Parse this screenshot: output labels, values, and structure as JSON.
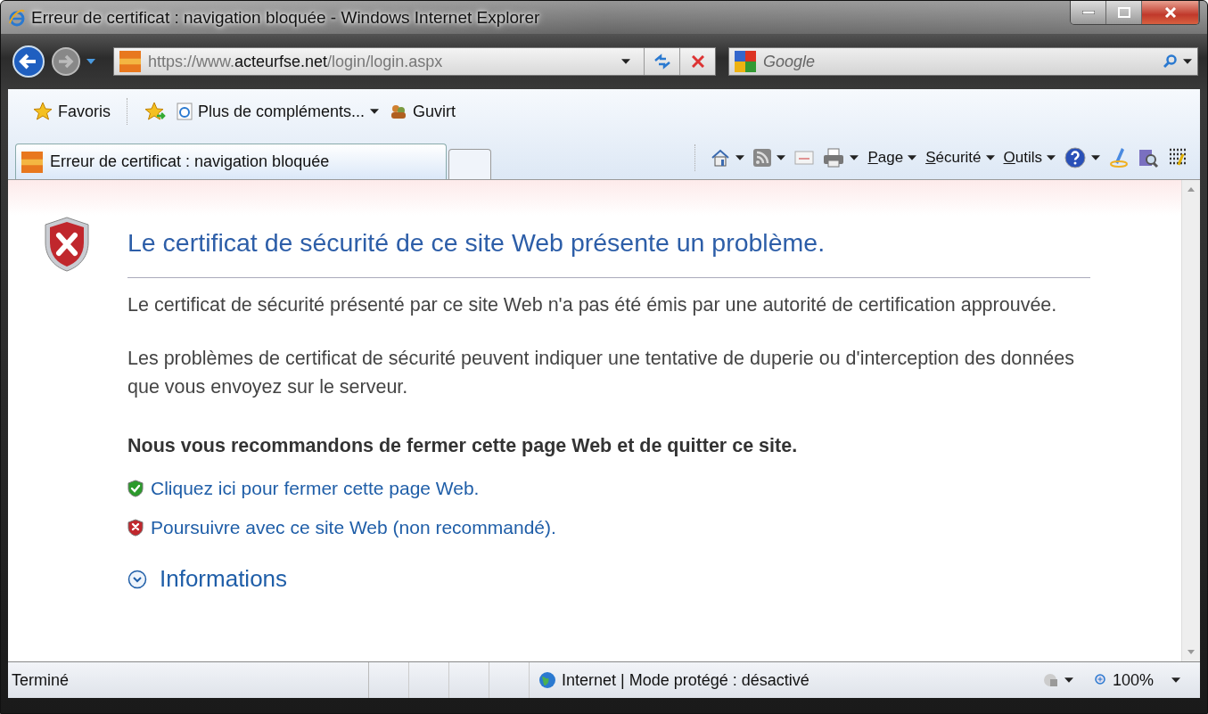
{
  "window": {
    "title": "Erreur de certificat : navigation bloquée - Windows Internet Explorer"
  },
  "address_bar": {
    "url_prefix": "https://www.",
    "url_domain": "acteurfse.net",
    "url_path": "/login/login.aspx"
  },
  "search": {
    "placeholder": "Google"
  },
  "favorites_bar": {
    "label": "Favoris",
    "items": [
      {
        "label": "Plus de compléments...",
        "kind": "dropdown"
      },
      {
        "label": "Guvirt",
        "kind": "link"
      }
    ]
  },
  "tabs": [
    {
      "label": "Erreur de certificat : navigation bloquée",
      "selected": true
    }
  ],
  "command_bar": {
    "menus": [
      "Page",
      "Sécurité",
      "Outils"
    ]
  },
  "content": {
    "heading": "Le certificat de sécurité de ce site Web présente un problème.",
    "paragraphs": [
      "Le certificat de sécurité présenté par ce site Web n'a pas été émis par une autorité de certification approuvée.",
      "Les problèmes de certificat de sécurité peuvent indiquer une tentative de duperie ou d'interception des données que vous envoyez sur le serveur."
    ],
    "recommendation": "Nous vous recommandons de fermer cette page Web et de quitter ce site.",
    "links": [
      {
        "text": "Cliquez ici pour fermer cette page Web.",
        "kind": "safe"
      },
      {
        "text": "Poursuivre avec ce site Web (non recommandé).",
        "kind": "unsafe"
      }
    ],
    "more_info": {
      "label": "Informations",
      "expanded": false
    }
  },
  "status_bar": {
    "text": "Terminé",
    "zone": "Internet | Mode protégé : désactivé",
    "zoom": "100%"
  }
}
